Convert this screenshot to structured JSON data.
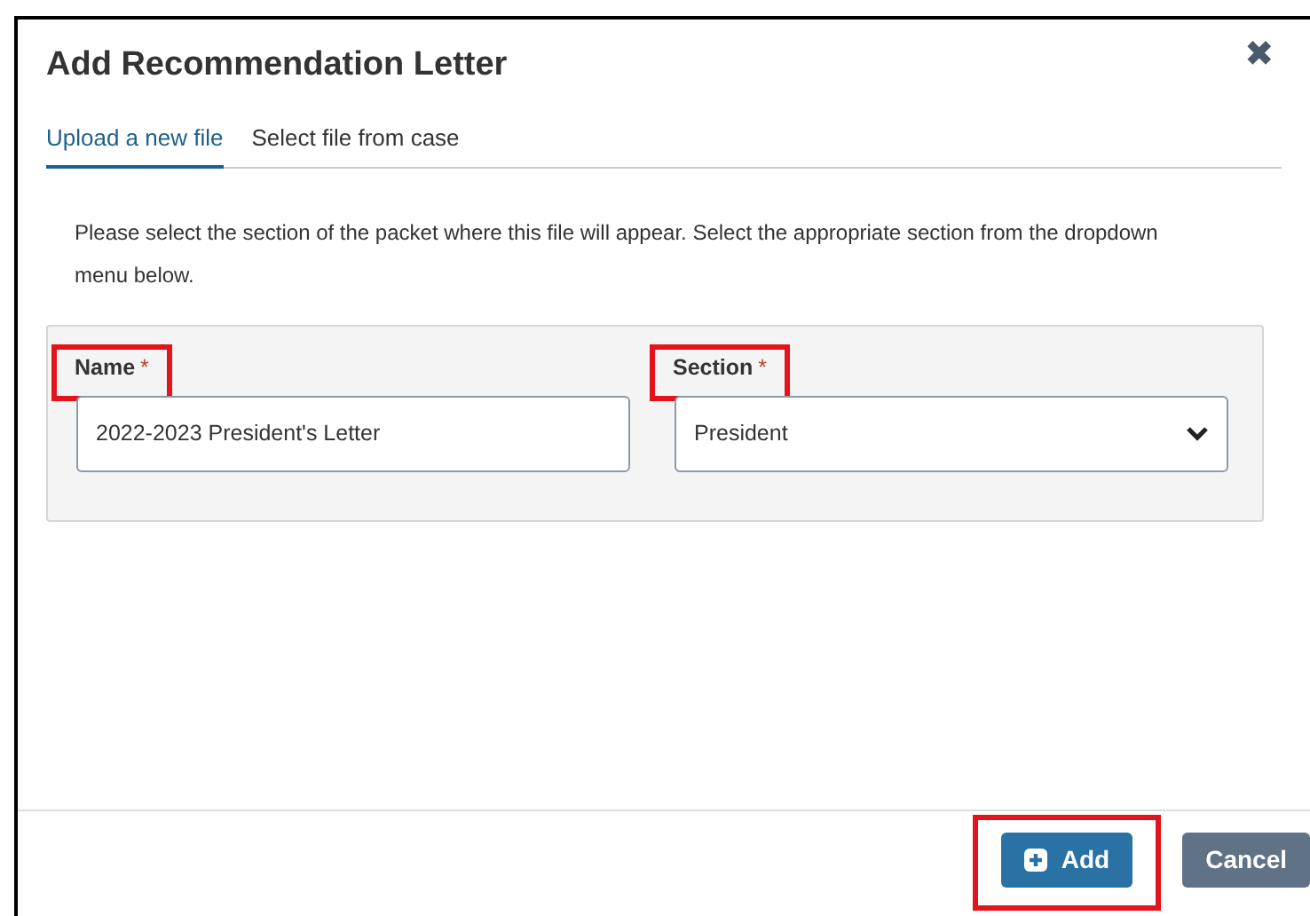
{
  "dialog": {
    "title": "Add Recommendation Letter",
    "close": "✖"
  },
  "tabs": [
    {
      "label": "Upload a new file",
      "selected": true
    },
    {
      "label": "Select file from case",
      "selected": false
    }
  ],
  "instructions": "Please select the section of the packet where this file will appear. Select the appropriate section from the dropdown menu below.",
  "fields": [
    {
      "kind": "text",
      "label": "Name",
      "required_mark": "*",
      "highlighted": true,
      "value": "2022-2023 President's Letter"
    },
    {
      "kind": "select",
      "label": "Section",
      "required_mark": "*",
      "highlighted": true,
      "value": "President"
    }
  ],
  "buttons": [
    {
      "kind": "primary",
      "label": "Add",
      "highlighted": true
    },
    {
      "kind": "secondary",
      "label": "Cancel",
      "highlighted": false
    }
  ]
}
